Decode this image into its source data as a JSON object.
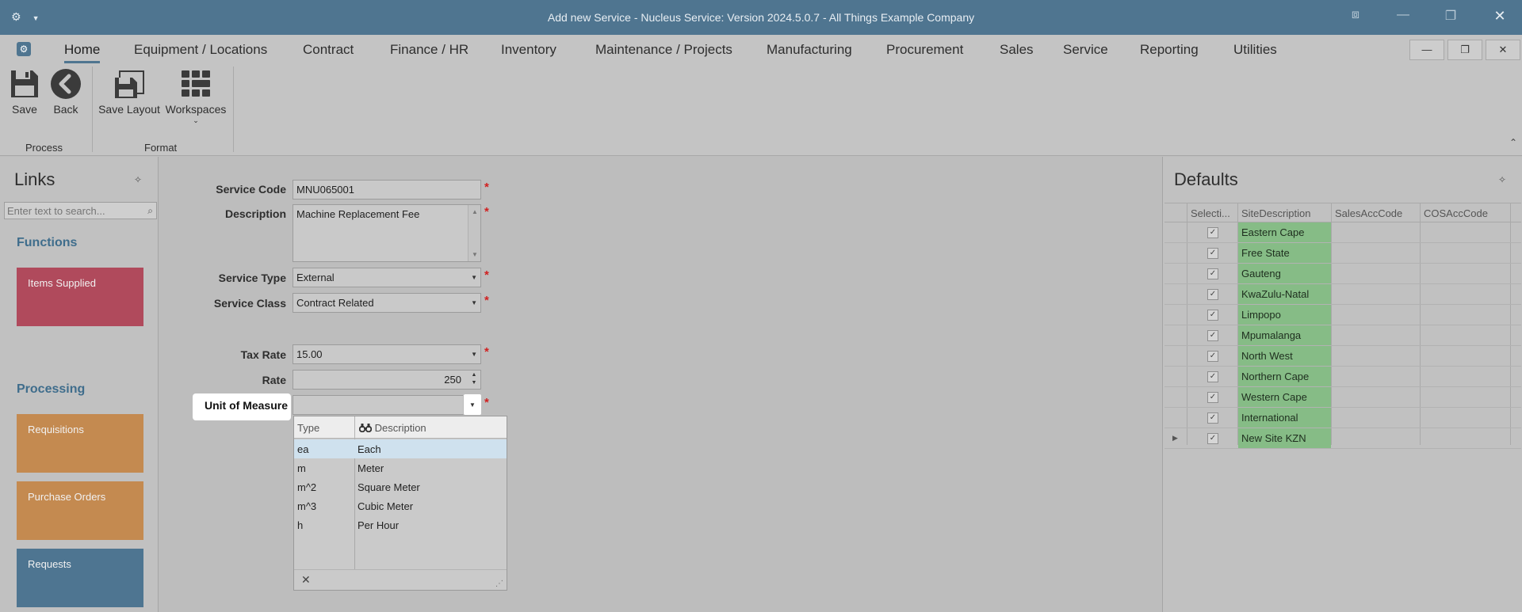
{
  "window": {
    "title": "Add new Service - Nucleus Service: Version 2024.5.0.7 - All Things Example Company",
    "app_menu_icon": "gear-icon",
    "controls": [
      "restore-icon",
      "minimize-icon",
      "maximize-icon",
      "close-icon"
    ]
  },
  "menu": {
    "tabs": [
      "Home",
      "Equipment / Locations",
      "Contract",
      "Finance / HR",
      "Inventory",
      "Maintenance / Projects",
      "Manufacturing",
      "Procurement",
      "Sales",
      "Service",
      "Reporting",
      "Utilities"
    ],
    "active_tab": "Home"
  },
  "ribbon": {
    "save_label": "Save",
    "back_label": "Back",
    "save_layout_label": "Save Layout",
    "workspaces_label": "Workspaces",
    "group_process": "Process",
    "group_format": "Format"
  },
  "links": {
    "title": "Links",
    "search_placeholder": "Enter text to search...",
    "functions_heading": "Functions",
    "items_supplied": "Items Supplied",
    "processing_heading": "Processing",
    "requisitions": "Requisitions",
    "purchase_orders": "Purchase Orders",
    "requests": "Requests",
    "colors": {
      "functions_tile": "#b04a5c",
      "processing_tile": "#c48a50",
      "requests_tile": "#4e7591"
    }
  },
  "form": {
    "service_code_label": "Service Code",
    "service_code_value": "MNU065001",
    "description_label": "Description",
    "description_value": "Machine Replacement Fee",
    "service_type_label": "Service Type",
    "service_type_value": "External",
    "service_class_label": "Service Class",
    "service_class_value": "Contract Related",
    "tax_rate_label": "Tax Rate",
    "tax_rate_value": "15.00",
    "rate_label": "Rate",
    "rate_value": "250",
    "uom_label": "Unit of Measure",
    "uom_value": "",
    "required_mark": "*"
  },
  "uom_dropdown": {
    "col_type": "Type",
    "col_description": "Description",
    "rows": [
      {
        "type": "ea",
        "description": "Each",
        "selected": true
      },
      {
        "type": "m",
        "description": "Meter"
      },
      {
        "type": "m^2",
        "description": "Square Meter"
      },
      {
        "type": "m^3",
        "description": "Cubic Meter"
      },
      {
        "type": "h",
        "description": "Per Hour"
      }
    ]
  },
  "defaults": {
    "title": "Defaults",
    "columns": [
      "Selecti...",
      "SiteDescription",
      "SalesAccCode",
      "COSAccCode"
    ],
    "rows": [
      {
        "selected": true,
        "site": "Eastern Cape",
        "sales": "",
        "cos": ""
      },
      {
        "selected": true,
        "site": "Free State",
        "sales": "",
        "cos": ""
      },
      {
        "selected": true,
        "site": "Gauteng",
        "sales": "",
        "cos": ""
      },
      {
        "selected": true,
        "site": "KwaZulu-Natal",
        "sales": "",
        "cos": ""
      },
      {
        "selected": true,
        "site": "Limpopo",
        "sales": "",
        "cos": ""
      },
      {
        "selected": true,
        "site": "Mpumalanga",
        "sales": "",
        "cos": ""
      },
      {
        "selected": true,
        "site": "North West",
        "sales": "",
        "cos": ""
      },
      {
        "selected": true,
        "site": "Northern Cape",
        "sales": "",
        "cos": ""
      },
      {
        "selected": true,
        "site": "Western Cape",
        "sales": "",
        "cos": ""
      },
      {
        "selected": true,
        "site": "International",
        "sales": "",
        "cos": ""
      },
      {
        "selected": true,
        "site": "New Site KZN",
        "sales": "",
        "cos": ""
      }
    ],
    "site_cell_color": "#86bc86"
  }
}
